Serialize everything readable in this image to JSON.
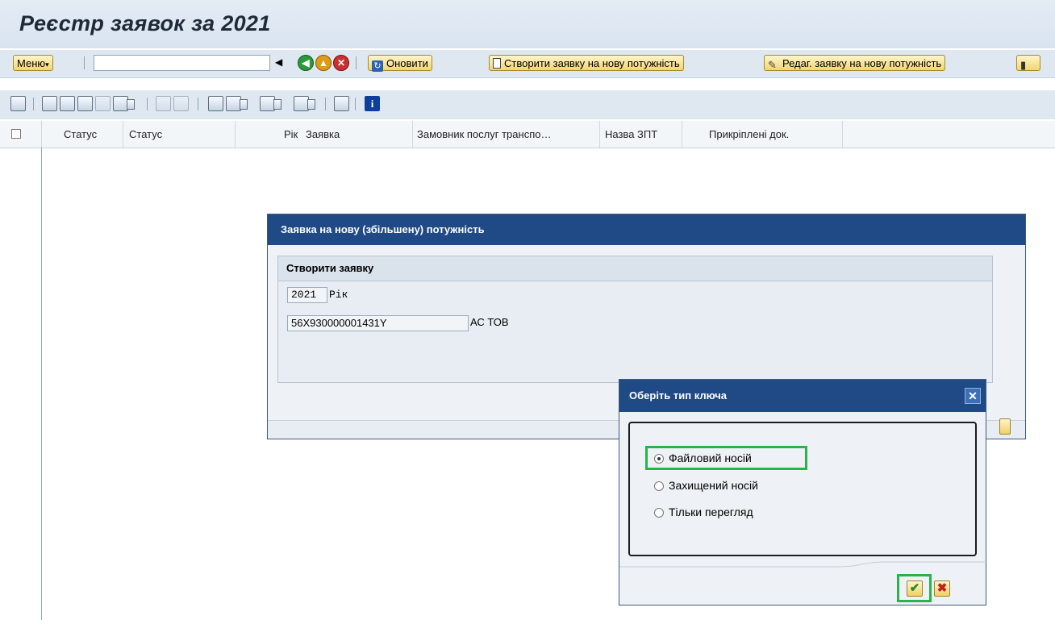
{
  "window": {
    "title": "Реєстр заявок за 2021"
  },
  "toolbar": {
    "menu_label": "Меню",
    "command_value": "",
    "refresh_label": "Оновити",
    "create_label": "Створити заявку на нову потужність",
    "edit_label": "Редаг. заявку на нову потужність"
  },
  "grid": {
    "columns": [
      "Статус",
      "Статус",
      "Рік",
      "Заявка",
      "Замовник послуг транспо…",
      "Назва ЗПТ",
      "Прикріплені док."
    ]
  },
  "dialog_request": {
    "title": "Заявка на нову (збільшену) потужність",
    "group_title": "Створити заявку",
    "year_value": "2021",
    "year_label": "Рік",
    "eic_value": "56X930000001431Y",
    "company_label": "АС ТОВ"
  },
  "dialog_key": {
    "title": "Оберіть тип ключа",
    "close_icon": "✕",
    "options": [
      "Файловий носій",
      "Захищений носій",
      "Тільки перегляд"
    ],
    "selected_index": 0,
    "confirm_icon": "✔",
    "cancel_icon": "✖"
  },
  "colors": {
    "title_bar": "#1f4a86",
    "highlight": "#2ab34a",
    "button": "#f3d66c"
  }
}
